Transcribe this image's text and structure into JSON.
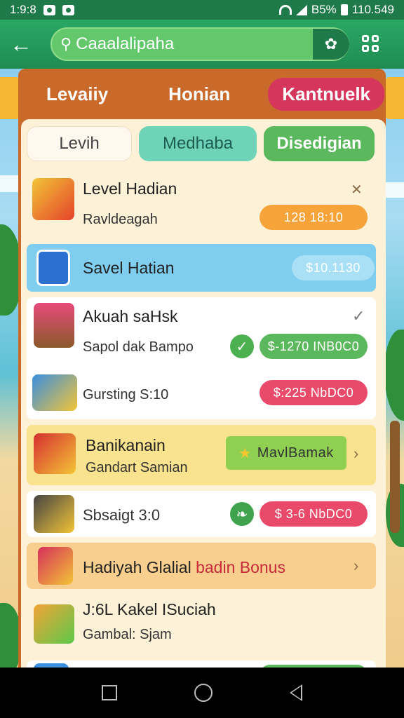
{
  "status_bar": {
    "time": "1:9:8",
    "battery": "B5%",
    "clock": "110.549"
  },
  "app_bar": {
    "search_text": "Caaalalipaha"
  },
  "top_tabs": [
    "Levaiiy",
    "Honian",
    "Kantnuelk"
  ],
  "sub_tabs": [
    "Levih",
    "Medhaba",
    "Disedigian"
  ],
  "rows": {
    "level": {
      "title": "Level Hadian",
      "subtitle": "Ravldeagah",
      "pill": "128 18:10"
    },
    "savel": {
      "title": "Savel Hatian",
      "pill": "$10.1130"
    },
    "akuah": {
      "title": "Akuah saHsk",
      "subtitle": "Sapol dak Bampo",
      "pill": "$-1270 INB0C0"
    },
    "gursting": {
      "subtitle": "Gursting S:10",
      "pill": "$:225 NbDC0"
    },
    "banikanain": {
      "title": "Banikanain",
      "subtitle": "Gandart Samian",
      "pill": "MavlBamak"
    },
    "sbsaigt": {
      "subtitle": "Sbsaigt 3:0",
      "pill": "$ 3-6 NbDC0"
    },
    "hadiyah": {
      "title_dark": "Hadiyah Glalial ",
      "title_red": "badin Bonus"
    },
    "kakel": {
      "title": "J:6L Kakel ISuciah",
      "subtitle": "Gambal: Sjam"
    }
  },
  "colors": {
    "status_bar": "#1f7a4a",
    "app_bar": "#2aa864",
    "panel": "#c96a2a",
    "active_tab": "#d6365c",
    "pill_orange": "#f6a43a",
    "pill_green": "#5cb85c",
    "pill_red": "#e94a6a",
    "pill_blue": "#7fcdef"
  },
  "icons": [
    "back-arrow-icon",
    "search-icon",
    "leaf-icon",
    "grid-icon",
    "gift-icon",
    "coupon-icon",
    "gem-basket-icon",
    "gem-box-icon",
    "red-envelope-icon",
    "star-icon",
    "chest-icon",
    "leaf-badge-icon",
    "present-icon",
    "green-gift-icon",
    "check-icon",
    "chevron-right-icon",
    "close-icon"
  ]
}
